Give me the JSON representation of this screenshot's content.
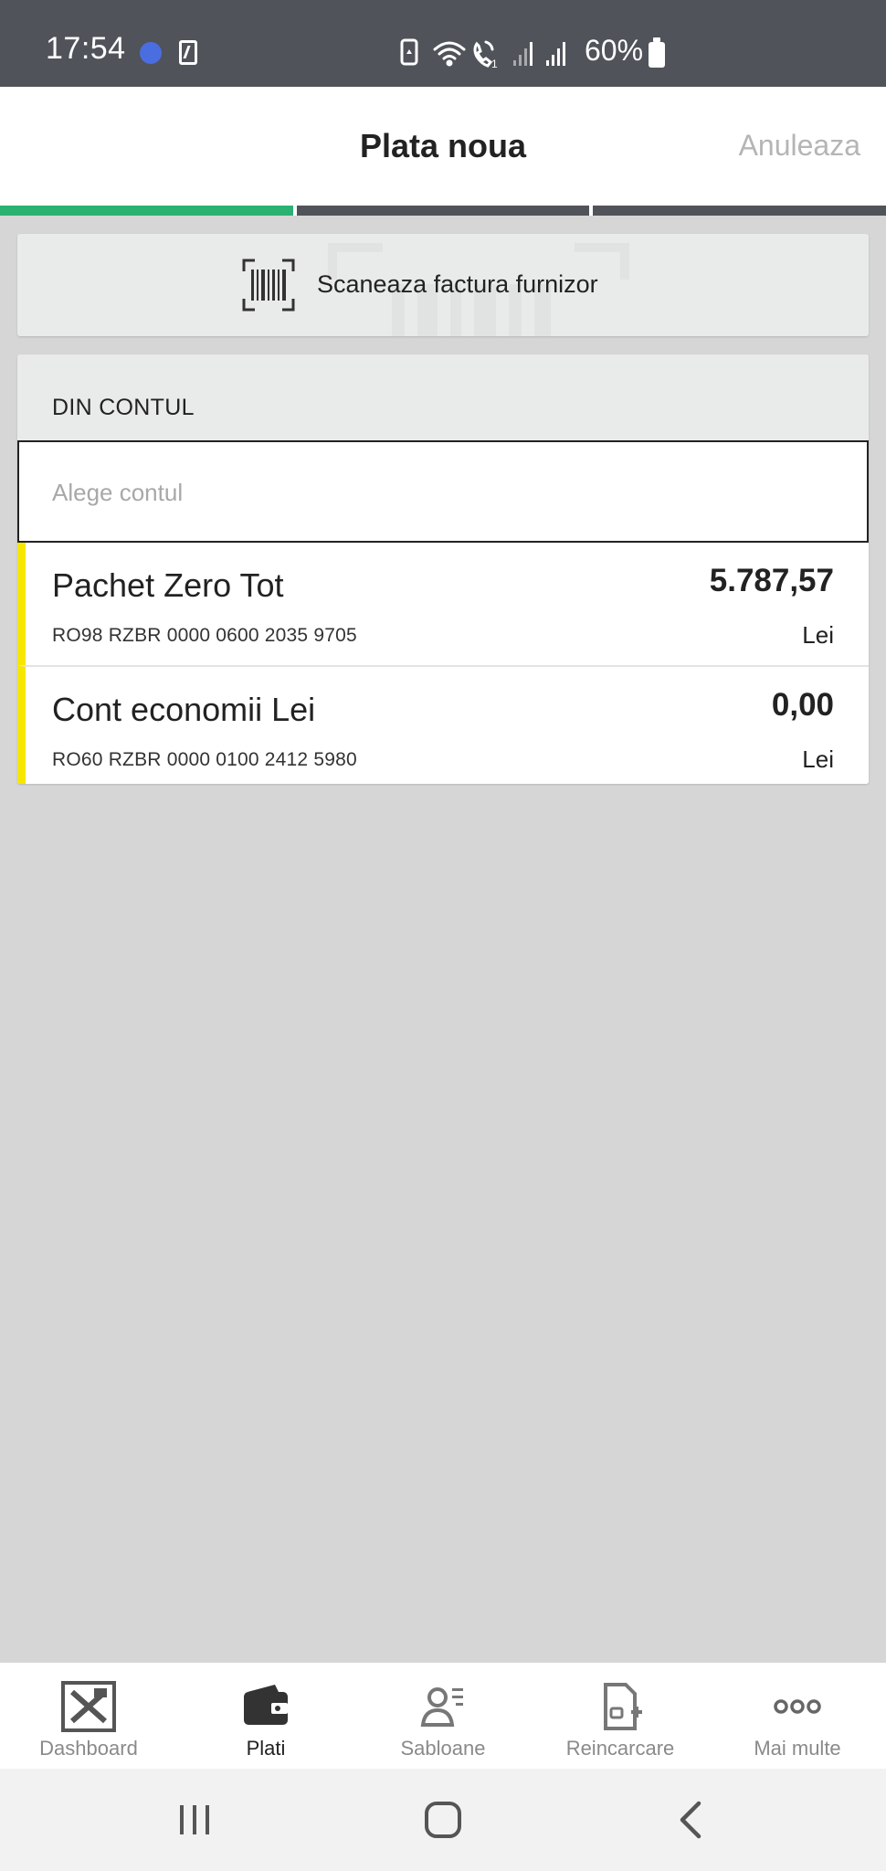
{
  "status_bar": {
    "time": "17:54",
    "battery_percent": "60%"
  },
  "header": {
    "title": "Plata noua",
    "cancel_label": "Anuleaza"
  },
  "progress": {
    "steps_total": 3,
    "current_step": 1,
    "active_color": "#2bb273",
    "pending_color": "#50535a"
  },
  "scan": {
    "label": "Scaneaza factura furnizor",
    "icon": "barcode-scan-icon"
  },
  "from_account": {
    "section_label": "DIN CONTUL",
    "placeholder": "Alege contul",
    "accent_color": "#f7e600",
    "accounts": [
      {
        "name": "Pachet Zero Tot",
        "iban": "RO98 RZBR 0000 0600 2035 9705",
        "amount": "5.787,57",
        "currency": "Lei"
      },
      {
        "name": "Cont economii Lei",
        "iban": "RO60 RZBR 0000 0100 2412 5980",
        "amount": "0,00",
        "currency": "Lei"
      }
    ]
  },
  "bottom_nav": {
    "items": [
      {
        "label": "Dashboard",
        "icon": "dashboard-icon",
        "active": false
      },
      {
        "label": "Plati",
        "icon": "wallet-icon",
        "active": true
      },
      {
        "label": "Sabloane",
        "icon": "templates-user-icon",
        "active": false
      },
      {
        "label": "Reincarcare",
        "icon": "top-up-document-icon",
        "active": false
      },
      {
        "label": "Mai multe",
        "icon": "more-dots-icon",
        "active": false
      }
    ]
  },
  "system_nav": {
    "icons": [
      "recent-apps-icon",
      "home-icon",
      "back-icon"
    ]
  }
}
